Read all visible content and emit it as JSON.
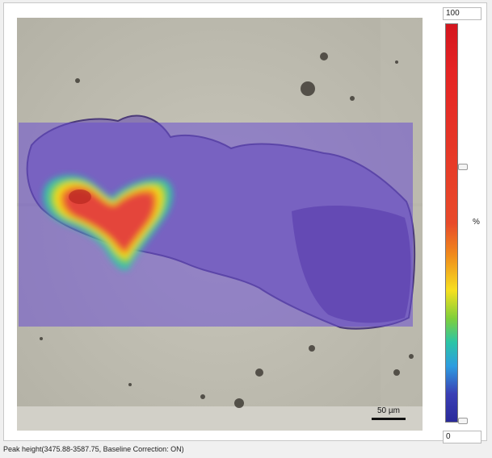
{
  "image_viewer": {
    "scale_bar_label": "50 µm"
  },
  "color_scale": {
    "max_value": "100",
    "min_value": "0",
    "unit": "%",
    "gradient_colors": [
      "#d4151e",
      "#e84a2a",
      "#f08a1c",
      "#f6e020",
      "#7fcf3a",
      "#2bc5a6",
      "#2d9de0",
      "#3a3fb5",
      "#2a2a9a"
    ]
  },
  "status_bar": {
    "text": "Peak height(3475.88-3587.75, Baseline Correction: ON)"
  },
  "colors": {
    "micrograph_background": "#c4c2b6",
    "overlay_base": "#6a4fd0",
    "hotspot_core": "#e4453a"
  }
}
